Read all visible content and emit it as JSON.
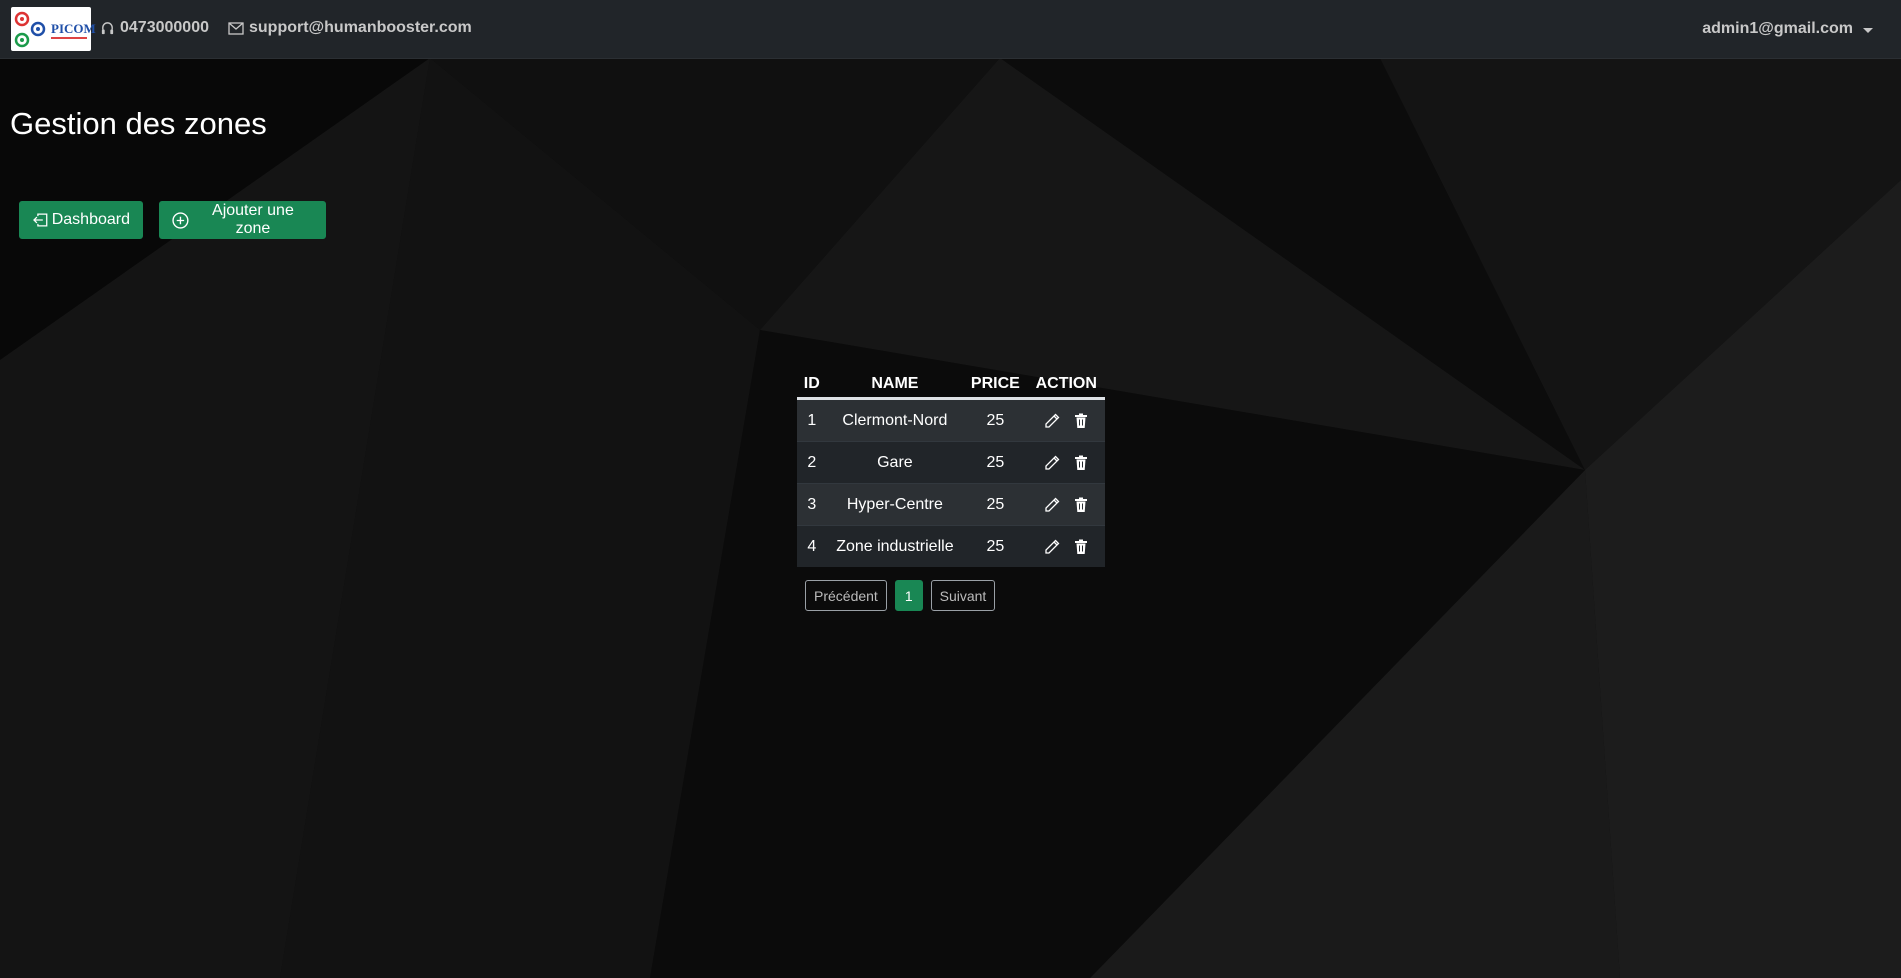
{
  "nav": {
    "logo_text": "PICOM",
    "phone": "0473000000",
    "email": "support@humanbooster.com",
    "user": "admin1@gmail.com"
  },
  "page": {
    "title": "Gestion des zones"
  },
  "actions": {
    "dashboard_label": "Dashboard",
    "add_zone_label": "Ajouter une zone"
  },
  "table": {
    "headers": [
      "ID",
      "NAME",
      "PRICE",
      "ACTION"
    ],
    "rows": [
      {
        "id": "1",
        "name": "Clermont-Nord",
        "price": "25"
      },
      {
        "id": "2",
        "name": "Gare",
        "price": "25"
      },
      {
        "id": "3",
        "name": "Hyper-Centre",
        "price": "25"
      },
      {
        "id": "4",
        "name": "Zone industrielle",
        "price": "25"
      }
    ]
  },
  "pagination": {
    "prev_label": "Précédent",
    "current_page": "1",
    "next_label": "Suivant"
  },
  "colors": {
    "accent": "#198754",
    "navbar": "#212529"
  },
  "icons": [
    "headset-icon",
    "envelope-icon",
    "box-arrow-left-icon",
    "plus-circle-icon",
    "pencil-icon",
    "trash-icon"
  ]
}
